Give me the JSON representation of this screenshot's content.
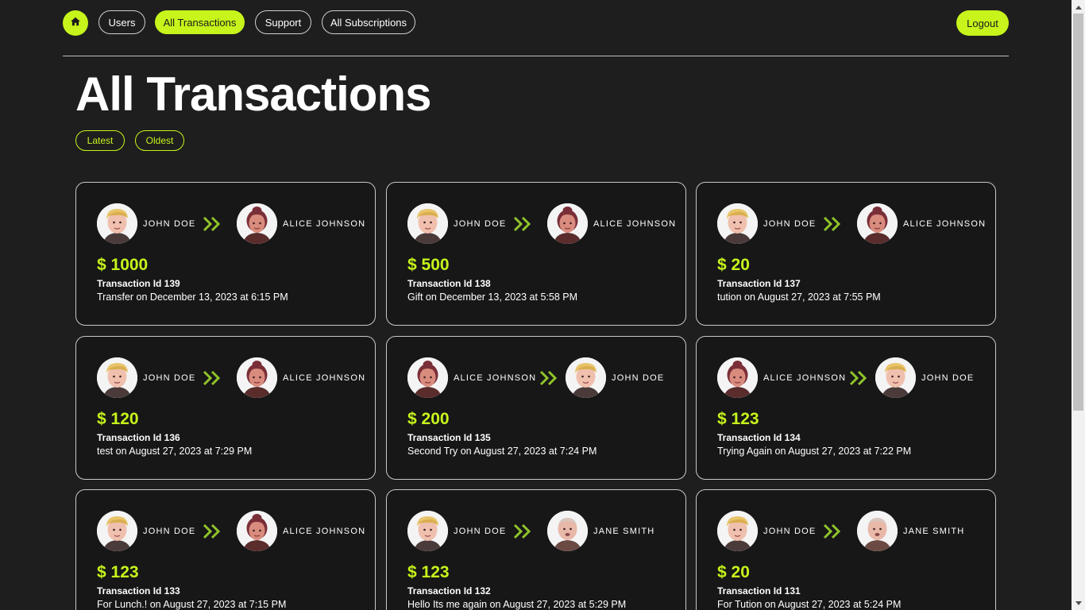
{
  "nav": {
    "home_icon": "home-icon",
    "items": [
      {
        "label": "Users",
        "active": false
      },
      {
        "label": "All Transactions",
        "active": true
      },
      {
        "label": "Support",
        "active": false
      },
      {
        "label": "All Subscriptions",
        "active": false
      }
    ],
    "logout_label": "Logout"
  },
  "page": {
    "title": "All Transactions",
    "sort_latest": "Latest",
    "sort_oldest": "Oldest"
  },
  "colors": {
    "accent": "#c6f41b",
    "background": "#1e1e1e",
    "card": "#171717"
  },
  "transactions": [
    {
      "from": "JOHN DOE",
      "from_avatar": "john",
      "to": "ALICE JOHNSON",
      "to_avatar": "alice",
      "amount": "$ 1000",
      "id_label": "Transaction Id 139",
      "desc": "Transfer on December 13, 2023 at 6:15 PM"
    },
    {
      "from": "JOHN DOE",
      "from_avatar": "john",
      "to": "ALICE JOHNSON",
      "to_avatar": "alice",
      "amount": "$ 500",
      "id_label": "Transaction Id 138",
      "desc": "Gift on December 13, 2023 at 5:58 PM"
    },
    {
      "from": "JOHN DOE",
      "from_avatar": "john",
      "to": "ALICE JOHNSON",
      "to_avatar": "alice",
      "amount": "$ 20",
      "id_label": "Transaction Id 137",
      "desc": "tution on August 27, 2023 at 7:55 PM"
    },
    {
      "from": "JOHN DOE",
      "from_avatar": "john",
      "to": "ALICE JOHNSON",
      "to_avatar": "alice",
      "amount": "$ 120",
      "id_label": "Transaction Id 136",
      "desc": "test on August 27, 2023 at 7:29 PM"
    },
    {
      "from": "ALICE JOHNSON",
      "from_avatar": "alice",
      "to": "JOHN DOE",
      "to_avatar": "john",
      "amount": "$ 200",
      "id_label": "Transaction Id 135",
      "desc": "Second Try on August 27, 2023 at 7:24 PM"
    },
    {
      "from": "ALICE JOHNSON",
      "from_avatar": "alice",
      "to": "JOHN DOE",
      "to_avatar": "john",
      "amount": "$ 123",
      "id_label": "Transaction Id 134",
      "desc": "Trying Again on August 27, 2023 at 7:22 PM"
    },
    {
      "from": "JOHN DOE",
      "from_avatar": "john",
      "to": "ALICE JOHNSON",
      "to_avatar": "alice",
      "amount": "$ 123",
      "id_label": "Transaction Id 133",
      "desc": "For Lunch.! on August 27, 2023 at 7:15 PM"
    },
    {
      "from": "JOHN DOE",
      "from_avatar": "john",
      "to": "JANE SMITH",
      "to_avatar": "jane",
      "amount": "$ 123",
      "id_label": "Transaction Id 132",
      "desc": "Hello Its me again on August 27, 2023 at 5:29 PM"
    },
    {
      "from": "JOHN DOE",
      "from_avatar": "john",
      "to": "JANE SMITH",
      "to_avatar": "jane",
      "amount": "$ 20",
      "id_label": "Transaction Id 131",
      "desc": "For Tution on August 27, 2023 at 5:24 PM"
    }
  ]
}
